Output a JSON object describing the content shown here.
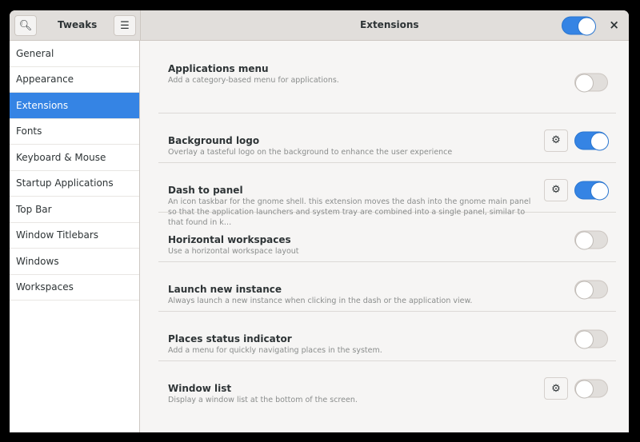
{
  "header": {
    "app_title": "Tweaks",
    "page_title": "Extensions",
    "extensions_enabled": true,
    "search_icon": "search-icon",
    "menu_icon": "hamburger-menu-icon",
    "close_label": "×"
  },
  "sidebar": {
    "items": [
      {
        "label": "General"
      },
      {
        "label": "Appearance"
      },
      {
        "label": "Extensions",
        "selected": true
      },
      {
        "label": "Fonts"
      },
      {
        "label": "Keyboard & Mouse"
      },
      {
        "label": "Startup Applications"
      },
      {
        "label": "Top Bar"
      },
      {
        "label": "Window Titlebars"
      },
      {
        "label": "Windows"
      },
      {
        "label": "Workspaces"
      }
    ]
  },
  "extensions": [
    {
      "name": "Applications menu",
      "description": "Add a category-based menu for applications.",
      "settings": false,
      "enabled": false
    },
    {
      "name": "Background logo",
      "description": "Overlay a tasteful logo on the background to enhance the user experience",
      "settings": true,
      "enabled": true
    },
    {
      "name": "Dash to panel",
      "description": "An icon taskbar for the gnome shell. this extension moves the dash into the gnome main panel so that the application launchers and system tray are combined into a single panel, similar to that found in k…",
      "settings": true,
      "enabled": true
    },
    {
      "name": "Horizontal workspaces",
      "description": "Use a horizontal workspace layout",
      "settings": false,
      "enabled": false
    },
    {
      "name": "Launch new instance",
      "description": "Always launch a new instance when clicking in the dash or the application view.",
      "settings": false,
      "enabled": false
    },
    {
      "name": "Places status indicator",
      "description": "Add a menu for quickly navigating places in the system.",
      "settings": false,
      "enabled": false
    },
    {
      "name": "Window list",
      "description": "Display a window list at the bottom of the screen.",
      "settings": true,
      "enabled": false
    }
  ],
  "colors": {
    "accent": "#3584e4",
    "header": "#e1dedb"
  }
}
